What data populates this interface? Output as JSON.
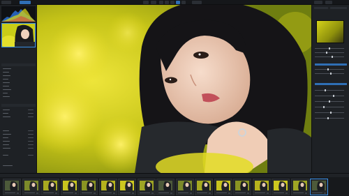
{
  "app": {
    "title": "",
    "left_header_label": "",
    "top_mode_label": ""
  },
  "colors": {
    "accent": "#2f6fb5",
    "selection": "#3a8fe6",
    "panel_bg": "#1e2125",
    "toolbar_bg": "#15171a",
    "flower_yellow": "#d8d40f"
  },
  "icons": [
    "histogram-icon",
    "color-swatch-icon",
    "film-thumb-icon",
    "star-rating-icon"
  ],
  "left_panel": {
    "sections": [
      {
        "name": "histogram"
      },
      {
        "name": "navigator-preview"
      },
      {
        "name": "adjustments"
      },
      {
        "name": "metadata"
      }
    ]
  },
  "filmstrip": {
    "count_shown": 17,
    "selected_index": 16
  }
}
